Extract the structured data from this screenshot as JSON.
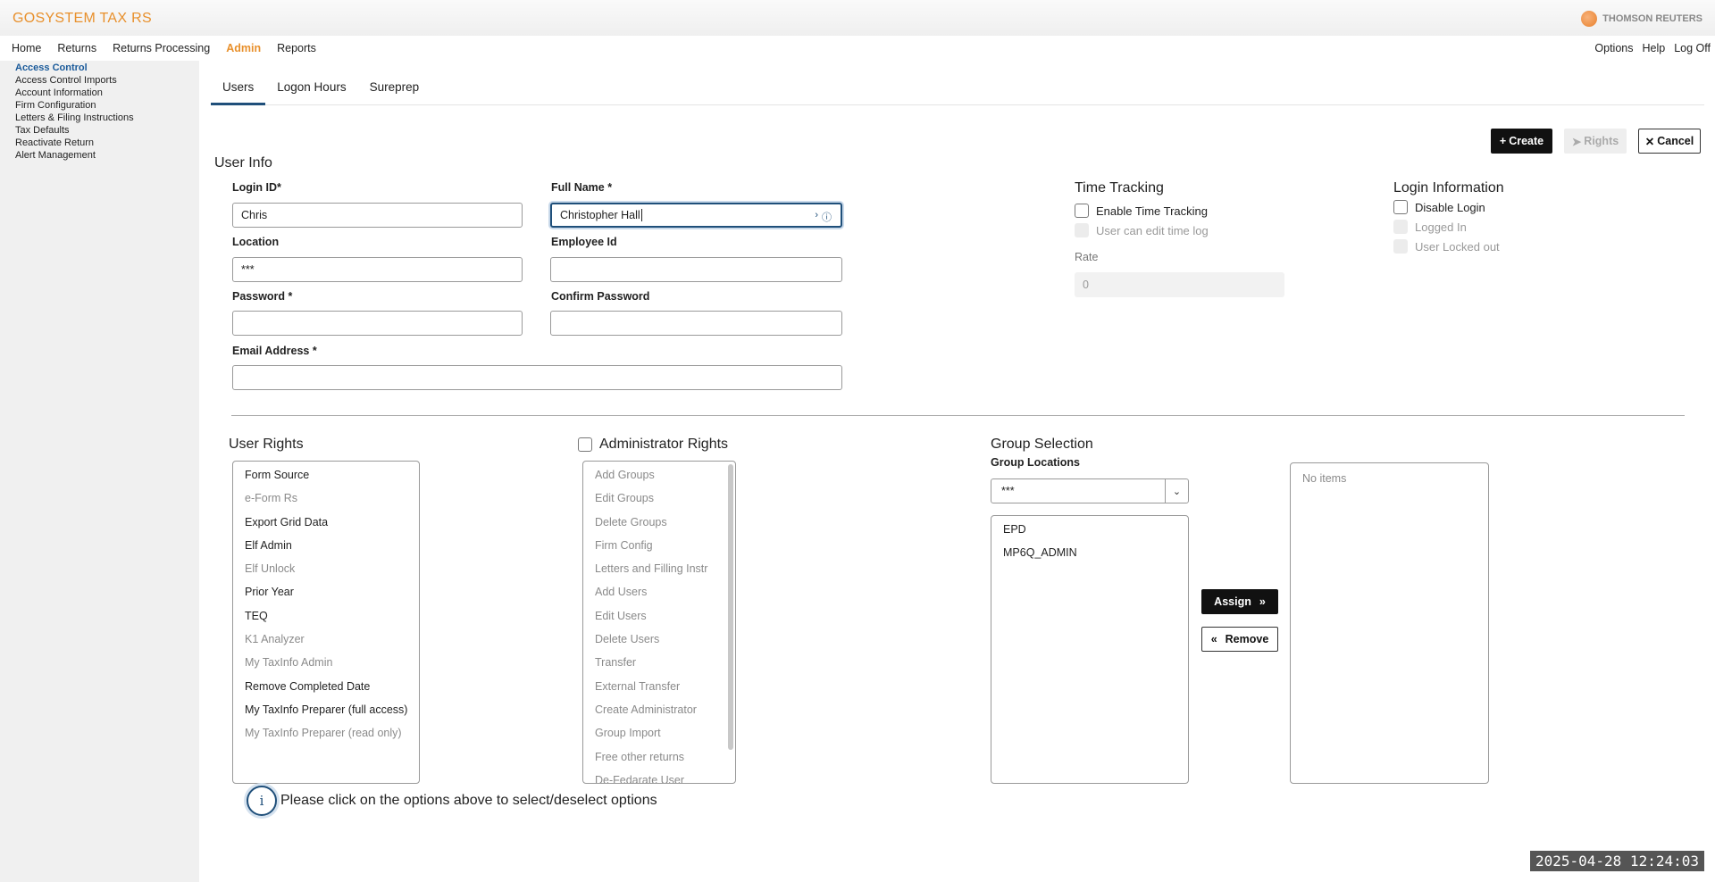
{
  "header": {
    "brand": "GOSYSTEM TAX RS",
    "logo_text": "THOMSON REUTERS"
  },
  "nav": {
    "items": [
      "Home",
      "Returns",
      "Returns Processing",
      "Admin",
      "Reports"
    ],
    "active": "Admin",
    "right_items": [
      "Options",
      "Help",
      "Log Off"
    ]
  },
  "sidebar": {
    "items": [
      "Access Control",
      "Access Control Imports",
      "Account Information",
      "Firm Configuration",
      "Letters & Filing Instructions",
      "Tax Defaults",
      "Reactivate Return",
      "Alert Management"
    ],
    "active": "Access Control"
  },
  "tabs": {
    "items": [
      "Users",
      "Logon Hours",
      "Sureprep"
    ],
    "active": "Users"
  },
  "actions": {
    "create": "Create",
    "rights": "Rights",
    "cancel": "Cancel"
  },
  "user_info": {
    "title": "User Info",
    "login_id_label": "Login ID*",
    "login_id_value": "Chris",
    "full_name_label": "Full Name *",
    "full_name_value": "Christopher Hall",
    "location_label": "Location",
    "location_value": "***",
    "employee_id_label": "Employee Id",
    "employee_id_value": "",
    "password_label": "Password *",
    "password_value": "",
    "confirm_password_label": "Confirm Password",
    "confirm_password_value": "",
    "email_label": "Email Address *",
    "email_value": ""
  },
  "time_tracking": {
    "title": "Time Tracking",
    "enable_label": "Enable Time Tracking",
    "enable_checked": false,
    "edit_log_label": "User can edit time log",
    "rate_label": "Rate",
    "rate_value": "0"
  },
  "login_information": {
    "title": "Login Information",
    "disable_label": "Disable Login",
    "logged_in_label": "Logged In",
    "locked_out_label": "User Locked out"
  },
  "user_rights": {
    "title": "User Rights",
    "items": [
      {
        "label": "Form Source",
        "enabled": true
      },
      {
        "label": "e-Form Rs",
        "enabled": false
      },
      {
        "label": "Export Grid Data",
        "enabled": true
      },
      {
        "label": "Elf Admin",
        "enabled": true
      },
      {
        "label": "Elf Unlock",
        "enabled": false
      },
      {
        "label": "Prior Year",
        "enabled": true
      },
      {
        "label": "TEQ",
        "enabled": true
      },
      {
        "label": "K1 Analyzer",
        "enabled": false
      },
      {
        "label": "My TaxInfo Admin",
        "enabled": false
      },
      {
        "label": "Remove Completed Date",
        "enabled": true
      },
      {
        "label": "My TaxInfo Preparer (full access)",
        "enabled": true
      },
      {
        "label": "My TaxInfo Preparer (read only)",
        "enabled": false
      }
    ]
  },
  "admin_rights": {
    "title": "Administrator Rights",
    "checked": false,
    "items": [
      "Add Groups",
      "Edit Groups",
      "Delete Groups",
      "Firm Config",
      "Letters and Filling Instr",
      "Add Users",
      "Edit Users",
      "Delete Users",
      "Transfer",
      "External Transfer",
      "Create Administrator",
      "Group Import",
      "Free other returns",
      "De-Fedarate User"
    ]
  },
  "group_selection": {
    "title": "Group Selection",
    "locations_label": "Group Locations",
    "locations_value": "***",
    "available": [
      "EPD",
      "MP6Q_ADMIN"
    ],
    "assign": "Assign",
    "remove": "Remove",
    "assigned_empty": "No items"
  },
  "info_note": "Please click on the options above to select/deselect options",
  "timestamp": "2025-04-28  12:24:03"
}
